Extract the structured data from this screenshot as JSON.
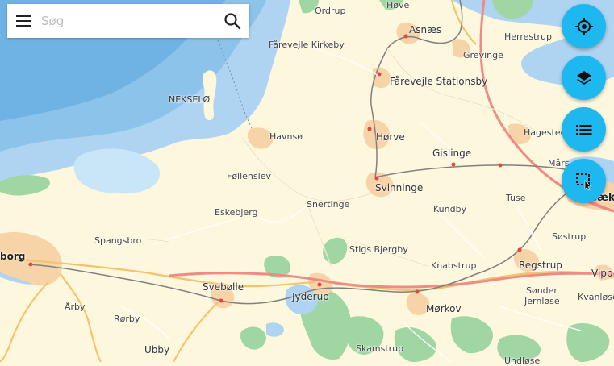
{
  "search": {
    "placeholder": "Søg"
  },
  "icons": {
    "menu": "menu-icon",
    "search": "search-icon",
    "locate": "gps-target-icon",
    "layers": "layers-icon",
    "list": "list-icon",
    "select_area": "select-area-icon"
  },
  "colors": {
    "fab": "#1eb8f0",
    "sea_deep": "#6fb2e4",
    "sea_shallow": "#aed4f1",
    "land": "#fdf7dd",
    "forest": "#9fd6a3",
    "urban": "#f7d3a8",
    "main_road": "#ef8a84",
    "secondary_road": "#f2c56b",
    "railway": "#777777"
  },
  "places": {
    "ordrup": "Ordrup",
    "hove": "Høve",
    "asnaes": "Asnæs",
    "herrestrup": "Herrestrup",
    "grevinge": "Grevinge",
    "farevejle_kirkeby": "Fårevejle Kirkeby",
    "farevejle_stationsby": "Fårevejle Stationsby",
    "nekselo": "NEKSELØ",
    "havnso": "Havnsø",
    "horve": "Hørve",
    "hagested": "Hagested",
    "gislinge": "Gislinge",
    "mars": "Mårs",
    "follenslev": "Føllenslev",
    "svinninge": "Svinninge",
    "tuse": "Tuse",
    "snertinge": "Snertinge",
    "kundby": "Kundby",
    "eskebjerg": "Eskebjerg",
    "spangsbro": "Spangsbro",
    "sostrup": "Søstrup",
    "borg": "borg",
    "stigs_bjergby": "Stigs Bjergby",
    "knabstrup": "Knabstrup",
    "regstrup": "Regstrup",
    "vipp": "Vipp",
    "svebolle": "Svebølle",
    "jyderup": "Jyderup",
    "sonder_jernlose_1": "Sønder",
    "sonder_jernlose_2": "Jernløse",
    "kvanlose": "Kvanløse",
    "arby": "Årby",
    "morkov": "Mørkov",
    "rorby": "Rørby",
    "ubby": "Ubby",
    "skamstrup": "Skamstrup",
    "undlose": "Undløse",
    "holbaek": "bæk"
  }
}
